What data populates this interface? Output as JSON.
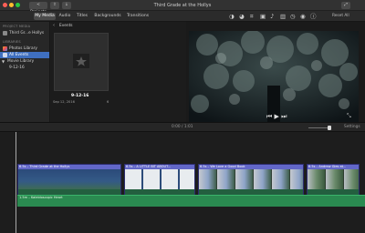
{
  "window": {
    "title": "Third Grade at the Hollys"
  },
  "toolbar": {
    "projects_label": "< Projects",
    "share_label": "⇪",
    "import_label": "↓"
  },
  "tabs": [
    {
      "label": "My Media",
      "active": true
    },
    {
      "label": "Audio"
    },
    {
      "label": "Titles"
    },
    {
      "label": "Backgrounds"
    },
    {
      "label": "Transitions"
    }
  ],
  "tools": {
    "reset_all_label": "Reset All"
  },
  "sidebar": {
    "project_media_header": "PROJECT MEDIA",
    "project_item": "Third Gr...e Hollys",
    "libraries_header": "LIBRARIES",
    "photos_library": "Photos Library",
    "all_events": "All Events",
    "movie_library": "Movie Library",
    "event_item": "9-12-16"
  },
  "browser": {
    "events_label": "Events",
    "event": {
      "title": "9-12-16",
      "date": "Sep 12, 2016",
      "count": "6"
    }
  },
  "timeline": {
    "timecode": "0:00  /  1:01",
    "settings_label": "Settings",
    "clips": [
      {
        "label": "6.5s – Third Grade at the Hollys"
      },
      {
        "label": "6.5s – A LITTLE BIT ABOUT..."
      },
      {
        "label": "6.5s – We Love a Good Book"
      },
      {
        "label": "6.5s – Andrew Gies at..."
      }
    ],
    "background_music": "1.5m – Kaleidoscopic Heart"
  },
  "colors": {
    "accent_blue": "#3f6fbf",
    "clip_title_bar": "#6267c8",
    "audio_green": "#2a8a50"
  }
}
